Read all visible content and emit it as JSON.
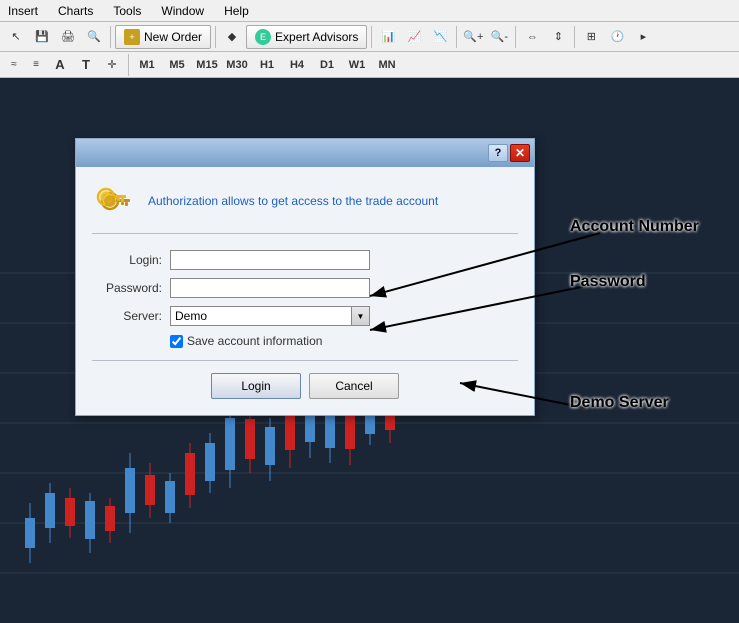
{
  "menubar": {
    "items": [
      "Insert",
      "Charts",
      "Tools",
      "Window",
      "Help"
    ]
  },
  "toolbar1": {
    "new_order_label": "New Order",
    "expert_advisors_label": "Expert Advisors",
    "timeframes": [
      "M1",
      "M5",
      "M15",
      "M30",
      "H1",
      "H4",
      "D1",
      "W1",
      "MN"
    ]
  },
  "dialog": {
    "help_btn": "?",
    "close_btn": "✕",
    "description": "Authorization allows to get access to the trade account",
    "login_label": "Login:",
    "password_label": "Password:",
    "server_label": "Server:",
    "server_value": "Demo",
    "save_checkbox_label": "Save account information",
    "login_btn": "Login",
    "cancel_btn": "Cancel"
  },
  "annotations": {
    "account_number": "Account Number",
    "password": "Password",
    "demo_server": "Demo Server"
  }
}
